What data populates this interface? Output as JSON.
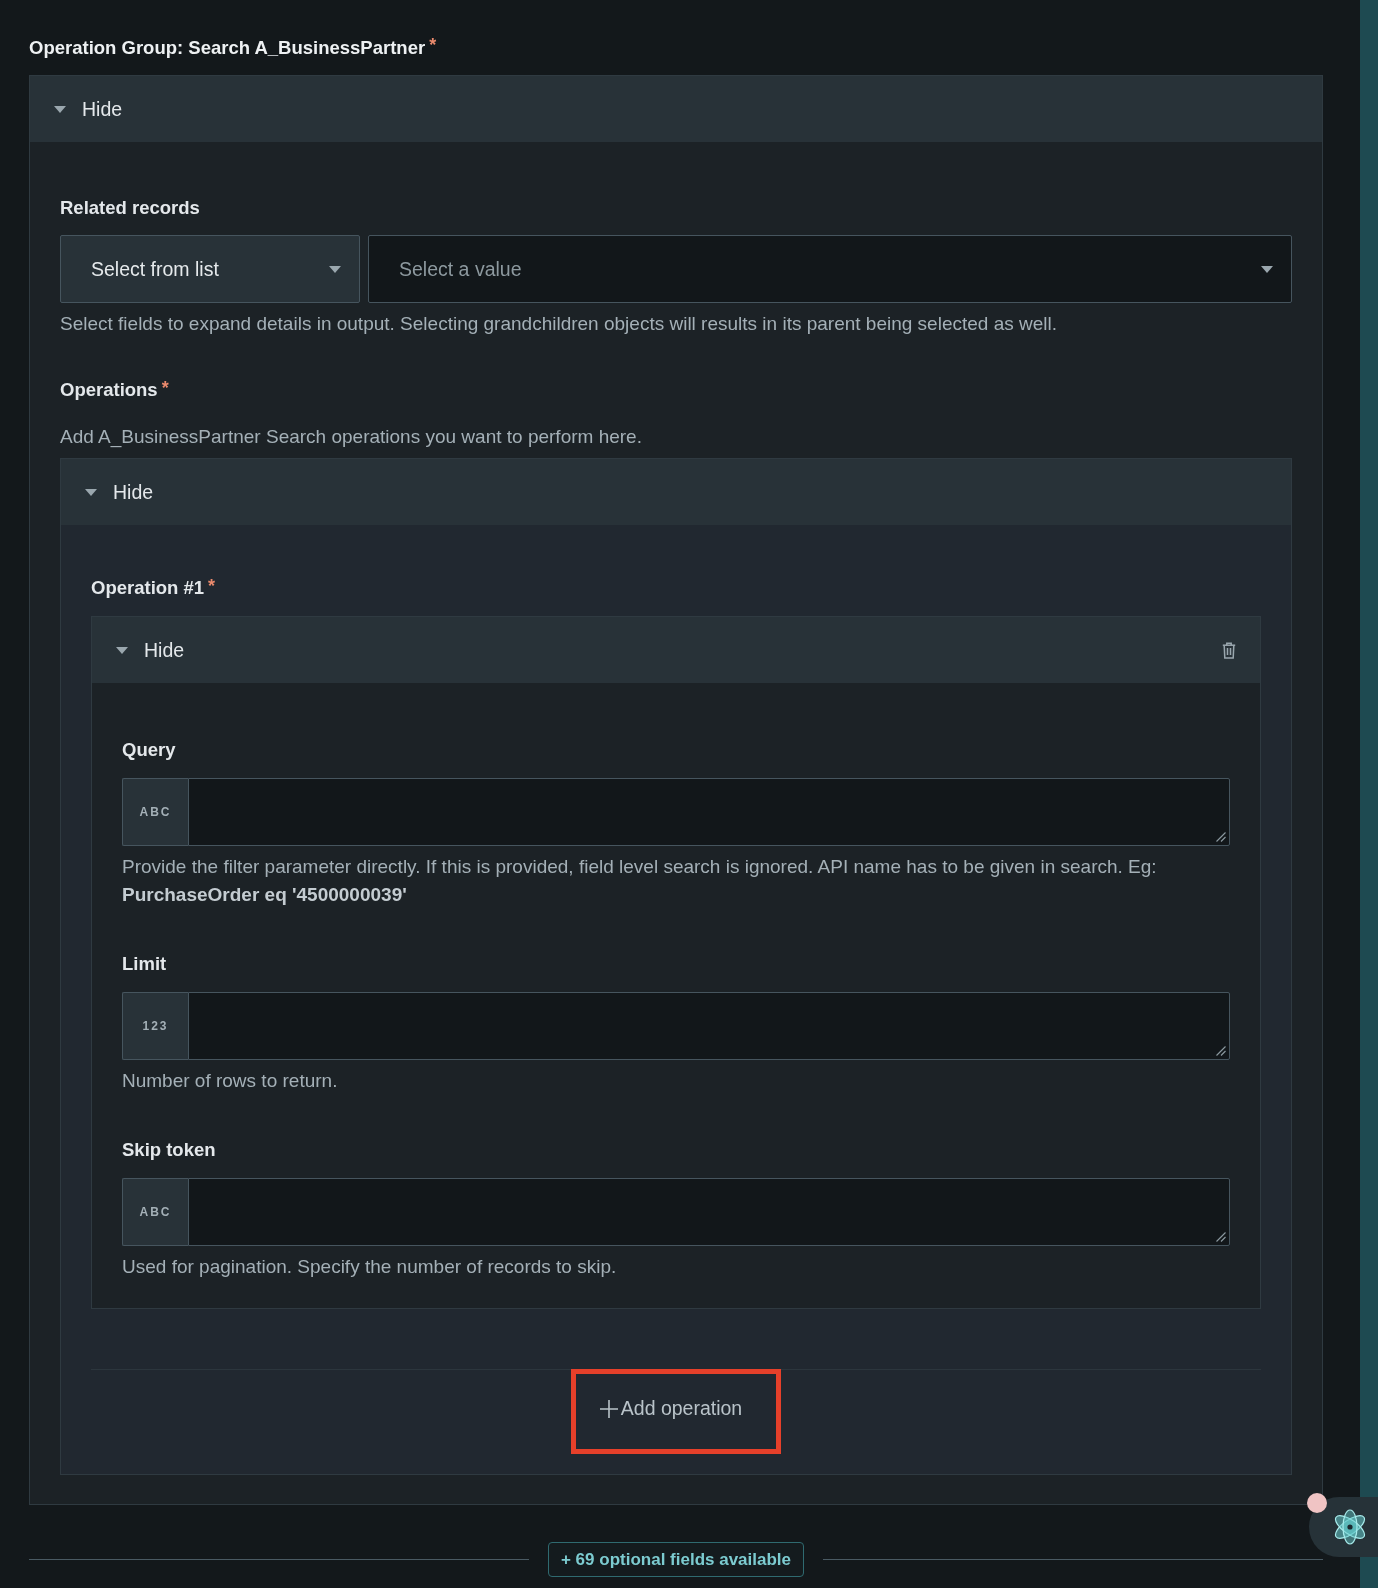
{
  "group": {
    "title": "Operation Group: Search A_BusinessPartner",
    "required_mark": "*",
    "toggle": {
      "label": "Hide",
      "expanded": true
    },
    "related_records": {
      "label": "Related records",
      "mode_select": "Select from list",
      "value_select": {
        "placeholder": "Select a value"
      },
      "help": "Select fields to expand details in output. Selecting grandchildren objects will results in its parent being selected as well."
    },
    "operations": {
      "label": "Operations",
      "required_mark": "*",
      "description": "Add A_BusinessPartner Search operations you want to perform here.",
      "toggle": {
        "label": "Hide",
        "expanded": true
      },
      "items": [
        {
          "title": "Operation #1",
          "required_mark": "*",
          "toggle": {
            "label": "Hide",
            "expanded": true
          },
          "fields": [
            {
              "label": "Query",
              "type_label": "ABC",
              "help": "Provide the filter parameter directly. If this is provided, field level search is ignored. API name has to be given in search. Eg: **PurchaseOrder eq '4500000039'**"
            },
            {
              "label": "Limit",
              "type_label": "123",
              "help": "Number of rows to return."
            },
            {
              "label": "Skip token",
              "type_label": "ABC",
              "help": "Used for pagination. Specify the number of records to skip."
            }
          ]
        }
      ],
      "add_button": {
        "label": "Add operation",
        "highlighted": true
      }
    }
  },
  "optional_fields": {
    "label": "+ 69 optional fields available"
  },
  "assistant": {
    "unread": true
  }
}
